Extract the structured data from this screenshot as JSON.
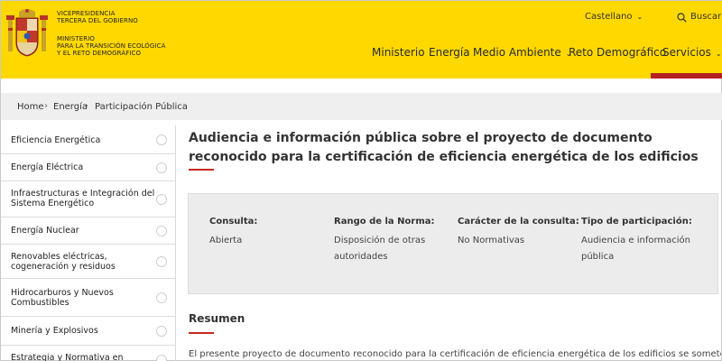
{
  "header": {
    "gov_line1": "VICEPRESIDENCIA",
    "gov_line2": "TERCERA DEL GOBIERNO",
    "ministry_line1": "MINISTERIO",
    "ministry_line2": "PARA LA TRANSICIÓN ECOLÓGICA",
    "ministry_line3": "Y EL RETO DEMOGRÁFICO",
    "language": "Castellano",
    "search_label": "Buscar",
    "nav": [
      "Ministerio",
      "Energía",
      "Medio Ambiente",
      "Reto Demográfico",
      "Servicios"
    ],
    "accent_color": "#ffd800",
    "red_color": "#b22222"
  },
  "breadcrumb": [
    "Home",
    "Energía",
    "Participación Pública"
  ],
  "sidebar": {
    "items": [
      "Eficiencia Energética",
      "Energía Eléctrica",
      "Infraestructuras e Integración del Sistema Energético",
      "Energía Nuclear",
      "Renovables eléctricas, cogeneración y residuos",
      "Hidrocarburos y Nuevos Combustibles",
      "Minería y Explosivos",
      "Estrategia y Normativa en Materia de"
    ]
  },
  "main": {
    "title": "Audiencia e información pública sobre el proyecto de documento reconocido para la certificación de eficiencia energética de los edificios",
    "info": [
      {
        "label": "Consulta:",
        "value": "Abierta"
      },
      {
        "label": "Rango de la Norma:",
        "value": "Disposición de otras autoridades"
      },
      {
        "label": "Carácter de la consulta:",
        "value": "No Normativas"
      },
      {
        "label": "Tipo de participación:",
        "value": "Audiencia e información pública"
      }
    ],
    "section_title": "Resumen",
    "summary": "El presente proyecto de documento reconocido para la certificación de eficiencia energética de los edificios se somete a audiencia"
  }
}
